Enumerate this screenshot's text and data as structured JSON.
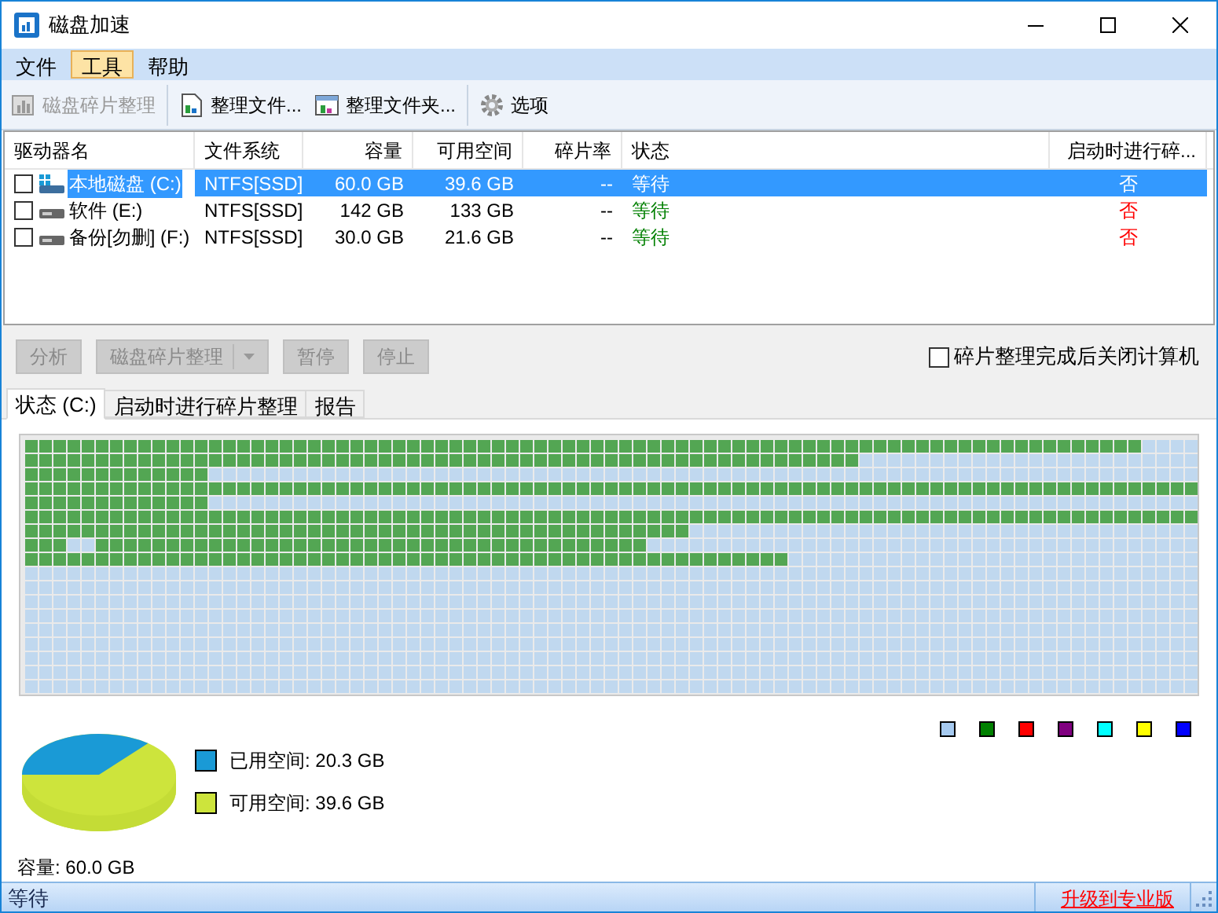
{
  "window": {
    "title": "磁盘加速"
  },
  "menu": [
    {
      "label": "文件",
      "selected": false
    },
    {
      "label": "工具",
      "selected": true
    },
    {
      "label": "帮助",
      "selected": false
    }
  ],
  "toolbar": [
    {
      "label": "磁盘碎片整理",
      "kind": "chart",
      "disabled": true
    },
    {
      "label": "整理文件...",
      "kind": "file",
      "disabled": false
    },
    {
      "label": "整理文件夹...",
      "kind": "folder",
      "disabled": false
    },
    {
      "label": "选项",
      "kind": "gear",
      "disabled": false
    }
  ],
  "table": {
    "columns": [
      "驱动器名",
      "文件系统",
      "容量",
      "可用空间",
      "碎片率",
      "状态",
      "启动时进行碎..."
    ],
    "rows": [
      {
        "kind": "system",
        "checked": false,
        "selected": true,
        "cells": [
          "本地磁盘 (C:)",
          "NTFS[SSD]",
          "60.0 GB",
          "39.6 GB",
          "--",
          "等待",
          "否"
        ]
      },
      {
        "kind": "drive",
        "checked": false,
        "selected": false,
        "cells": [
          "软件 (E:)",
          "NTFS[SSD]",
          "142 GB",
          "133 GB",
          "--",
          "等待",
          "否"
        ]
      },
      {
        "kind": "drive",
        "checked": false,
        "selected": false,
        "cells": [
          "备份[勿删] (F:)",
          "NTFS[SSD]",
          "30.0 GB",
          "21.6 GB",
          "--",
          "等待",
          "否"
        ]
      }
    ]
  },
  "actions": [
    {
      "label": "分析",
      "disabled": true,
      "dropdown": false
    },
    {
      "label": "磁盘碎片整理",
      "disabled": true,
      "dropdown": true
    },
    {
      "label": "暂停",
      "disabled": true,
      "dropdown": false
    },
    {
      "label": "停止",
      "disabled": true,
      "dropdown": false
    }
  ],
  "shutdown_option": {
    "label": "碎片整理完成后关闭计算机",
    "checked": false
  },
  "tabs": [
    {
      "label": "状态 (C:)",
      "selected": true
    },
    {
      "label": "启动时进行碎片整理",
      "selected": false
    },
    {
      "label": "报告",
      "selected": false
    }
  ],
  "legend_colors": [
    {
      "color": "#a6caf0"
    },
    {
      "color": "#008000"
    },
    {
      "color": "#ff0000"
    },
    {
      "color": "#800080"
    },
    {
      "color": "#00ffff"
    },
    {
      "color": "#ffff00"
    },
    {
      "color": "#0000ff"
    }
  ],
  "usage": [
    {
      "label": "已用空间: 20.3 GB",
      "color": "#1a9ad6"
    },
    {
      "label": "可用空间: 39.6 GB",
      "color": "#cde43c"
    }
  ],
  "capacity": "容量: 60.0 GB",
  "status_bar": {
    "text": "等待",
    "link": "升级到专业版"
  }
}
